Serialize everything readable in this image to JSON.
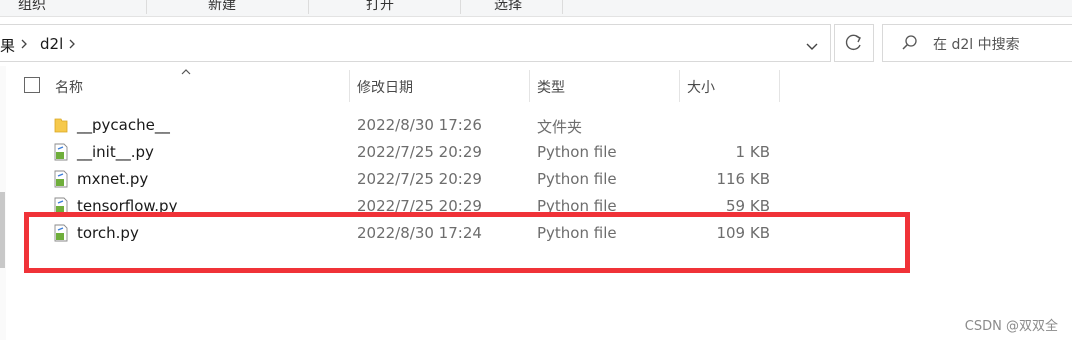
{
  "ribbon": {
    "groups": [
      "组织",
      "新建",
      "打开",
      "选择"
    ]
  },
  "address": {
    "crumbs": [
      "果",
      "d2l"
    ],
    "search_placeholder": "在 d2l 中搜索"
  },
  "columns": {
    "name": "名称",
    "date": "修改日期",
    "type": "类型",
    "size": "大小"
  },
  "files": [
    {
      "name": "__pycache__",
      "date": "2022/8/30 17:26",
      "type": "文件夹",
      "size": "",
      "icon": "folder-icon"
    },
    {
      "name": "__init__.py",
      "date": "2022/7/25 20:29",
      "type": "Python file",
      "size": "1 KB",
      "icon": "python-file-icon"
    },
    {
      "name": "mxnet.py",
      "date": "2022/7/25 20:29",
      "type": "Python file",
      "size": "116 KB",
      "icon": "python-file-icon"
    },
    {
      "name": "tensorflow.py",
      "date": "2022/7/25 20:29",
      "type": "Python file",
      "size": "59 KB",
      "icon": "python-file-icon"
    },
    {
      "name": "torch.py",
      "date": "2022/8/30 17:24",
      "type": "Python file",
      "size": "109 KB",
      "icon": "python-file-icon"
    }
  ],
  "highlight_color": "#f03238",
  "watermark": "CSDN @双双全"
}
